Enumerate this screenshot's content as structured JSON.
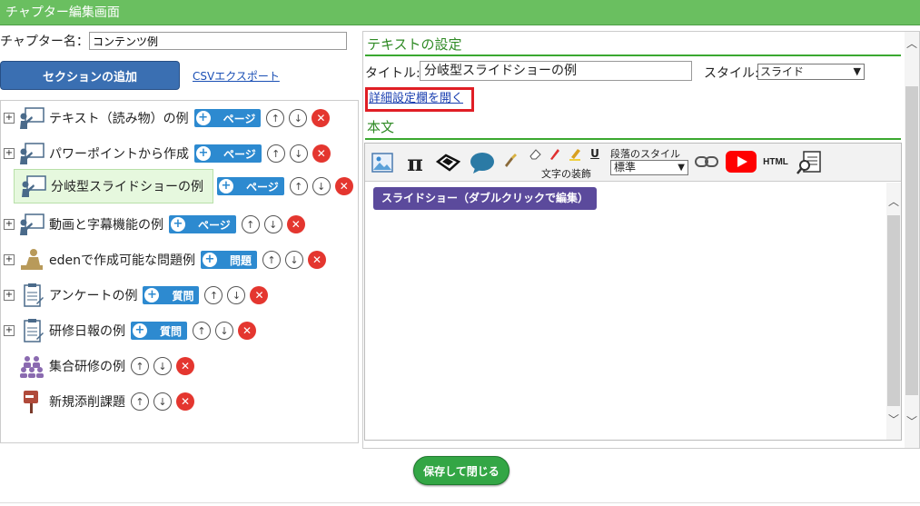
{
  "window": {
    "title": "チャプター編集画面"
  },
  "chapter": {
    "label": "チャプター名：",
    "value": "コンテンツ例"
  },
  "actions": {
    "add_section": "セクションの追加",
    "csv_export": "CSVエクスポート",
    "save_close": "保存して閉じる"
  },
  "tree": {
    "items": [
      {
        "label": "テキスト（読み物）の例",
        "add": "ページ",
        "icon": "lecture-icon",
        "expand": "+"
      },
      {
        "label": "パワーポイントから作成",
        "add": "ページ",
        "icon": "lecture-icon",
        "expand": "+"
      },
      {
        "label": "分岐型スライドショーの例",
        "add": "ページ",
        "icon": "lecture-icon",
        "selected": true
      },
      {
        "label": "動画と字幕機能の例",
        "add": "ページ",
        "icon": "lecture-icon",
        "expand": "+"
      },
      {
        "label": "edenで作成可能な問題例",
        "add": "問題",
        "icon": "exam-icon",
        "expand": "+"
      },
      {
        "label": "アンケートの例",
        "add": "質問",
        "icon": "clipboard-icon",
        "expand": "+"
      },
      {
        "label": "研修日報の例",
        "add": "質問",
        "icon": "clipboard-icon",
        "expand": "+"
      },
      {
        "label": "集合研修の例",
        "icon": "group-icon"
      },
      {
        "label": "新規添削課題",
        "icon": "post-icon"
      }
    ]
  },
  "text_settings": {
    "heading": "テキストの設定",
    "title_label": "タイトル:",
    "title_value": "分岐型スライドショーの例",
    "style_label": "スタイル:",
    "style_value": "スライド",
    "detail_link": "詳細設定欄を開く",
    "body_heading": "本文"
  },
  "editor": {
    "paragraph_style_label": "段落のスタイル",
    "paragraph_style_value": "標準",
    "text_decoration_label": "文字の装飾",
    "pi_glyph": "π",
    "underline_glyph": "U",
    "html_label": "HTML",
    "slideshow_block": "スライドショー（ダブルクリックで編集）"
  },
  "colors": {
    "titlebar": "#6abf60",
    "accent_blue": "#2d8ad0",
    "delete_red": "#e4362f",
    "highlight": "#e01e25"
  }
}
